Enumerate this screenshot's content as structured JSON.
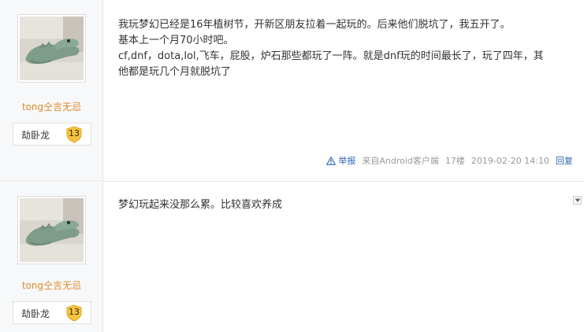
{
  "posts": [
    {
      "username": "tong仝言无忌",
      "badge": {
        "label": "劫卧龙",
        "level": "13"
      },
      "content": [
        "我玩梦幻已经是16年植树节，开新区朋友拉着一起玩的。后来他们脱坑了，我五开了。",
        "基本上一个月70小时吧。",
        "cf,dnf，dota,lol,飞车，屁股，炉石那些都玩了一阵。就是dnf玩的时间最长了，玩了四年，其",
        "他都是玩几个月就脱坑了"
      ],
      "tail": {
        "report": "举报",
        "source": "来自Android客户端",
        "floor": "17楼",
        "time": "2019-02-20 14:10",
        "reply": "回复"
      }
    },
    {
      "username": "tong仝言无忌",
      "badge": {
        "label": "劫卧龙",
        "level": "13"
      },
      "content": [
        "梦幻玩起来没那么累。比较喜欢养成"
      ]
    }
  ],
  "colors": {
    "username": "#e08a2b",
    "link": "#2d64b3",
    "meta": "#999999",
    "sidebar_bg": "#f7f8fa",
    "badge_level": "#f5c342"
  },
  "icons": {
    "report": "warning-triangle-icon",
    "level": "shield-level-icon",
    "dropdown": "chevron-down-icon"
  }
}
